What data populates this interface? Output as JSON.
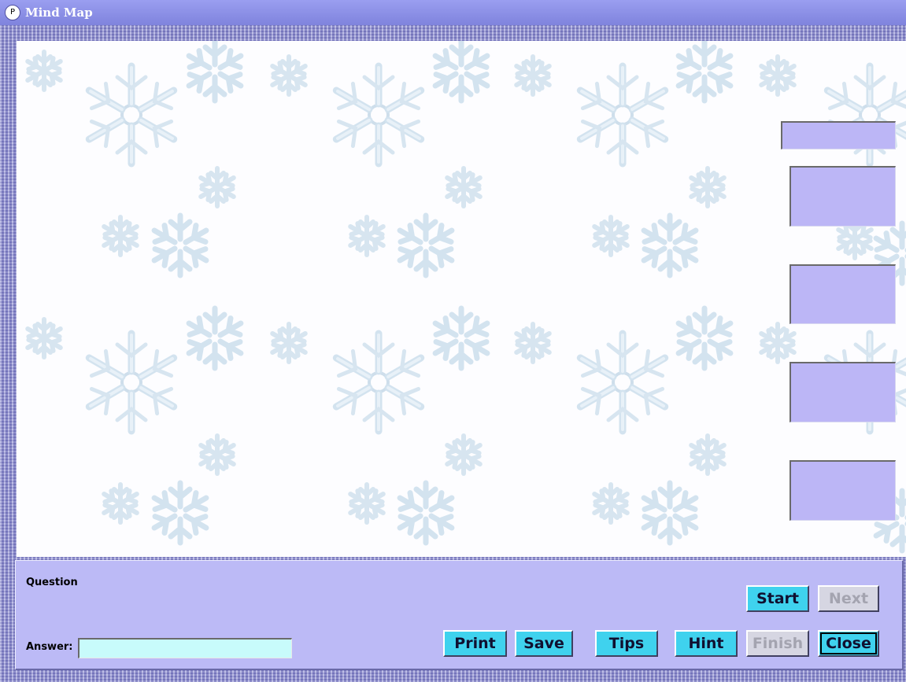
{
  "window": {
    "title": "Mind Map",
    "icon": "app-icon"
  },
  "colors": {
    "node_fill": "#bcb6f6",
    "panel_bg": "#bcbaf6",
    "active_button": "#3fd2ee",
    "disabled_button": "#d6d6e2",
    "answer_bg": "#c8fbfb",
    "snowflake": "#dbe9f4"
  },
  "panel": {
    "question_label": "Question",
    "answer_label": "Answer:",
    "answer_value": ""
  },
  "buttons": {
    "start": "Start",
    "next": "Next",
    "print": "Print",
    "save": "Save",
    "tips": "Tips",
    "hint": "Hint",
    "finish": "Finish",
    "close": "Close"
  }
}
